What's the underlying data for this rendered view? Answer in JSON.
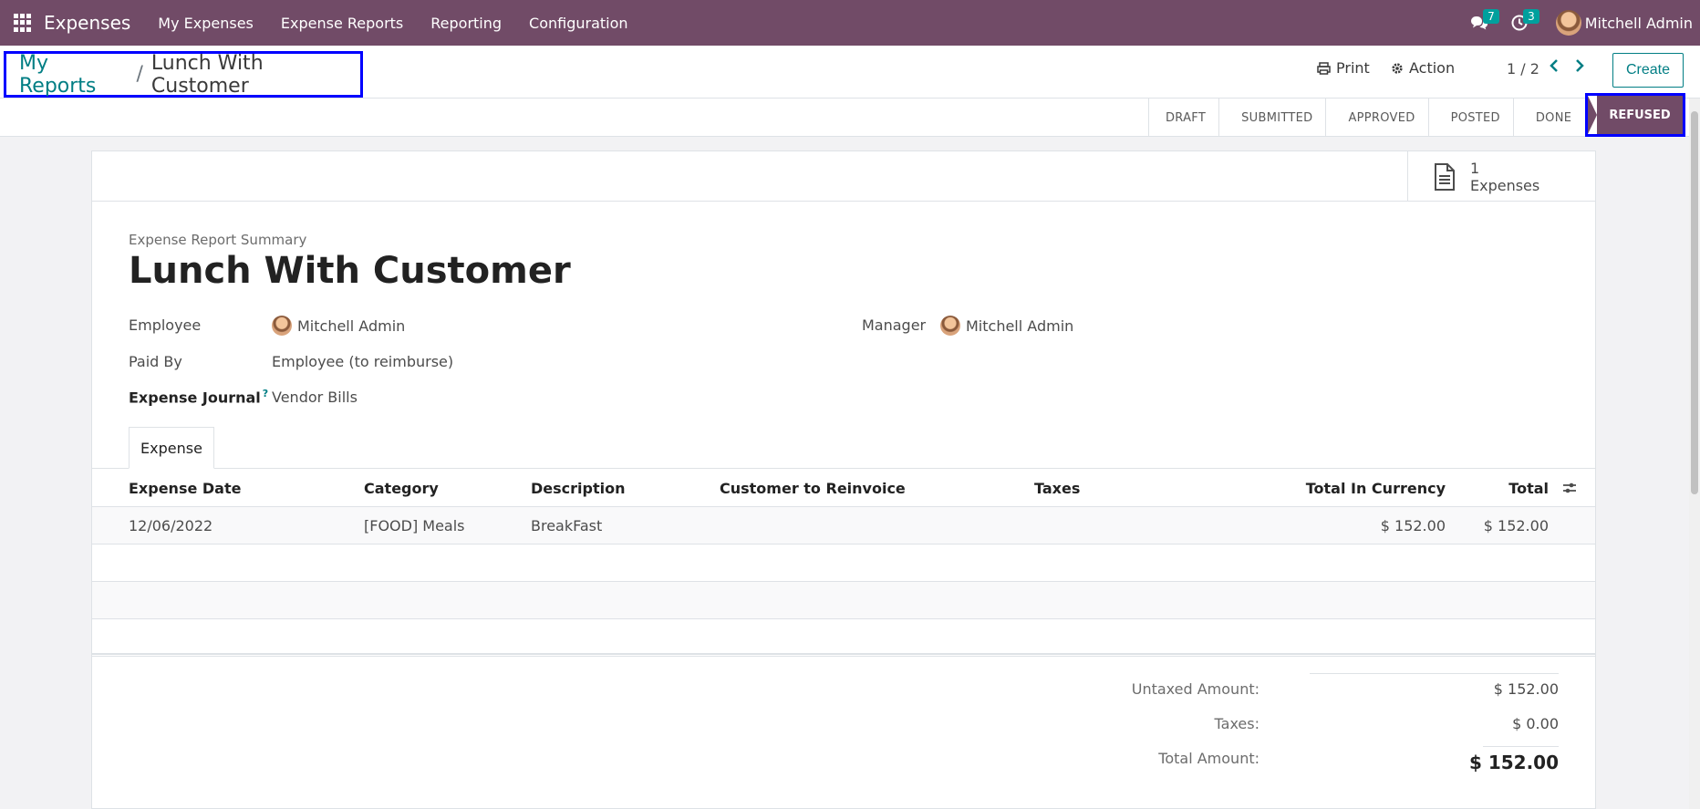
{
  "navbar": {
    "app_name": "Expenses",
    "menu": [
      "My Expenses",
      "Expense Reports",
      "Reporting",
      "Configuration"
    ],
    "messages_count": "7",
    "activities_count": "3",
    "user_name": "Mitchell Admin"
  },
  "control_panel": {
    "breadcrumb_parent": "My Reports",
    "breadcrumb_separator": "/",
    "breadcrumb_current": "Lunch With Customer",
    "print_label": "Print",
    "action_label": "Action",
    "pager_value": "1 / 2",
    "create_label": "Create"
  },
  "statusbar": {
    "stages": [
      "DRAFT",
      "SUBMITTED",
      "APPROVED",
      "POSTED",
      "DONE"
    ],
    "active_stage": "REFUSED"
  },
  "smart_button": {
    "count": "1",
    "label": "Expenses"
  },
  "form": {
    "subtitle": "Expense Report Summary",
    "title": "Lunch With Customer",
    "employee_label": "Employee",
    "employee_value": "Mitchell Admin",
    "manager_label": "Manager",
    "manager_value": "Mitchell Admin",
    "paid_by_label": "Paid By",
    "paid_by_value": "Employee (to reimburse)",
    "journal_label": "Expense Journal",
    "journal_help": "?",
    "journal_value": "Vendor Bills"
  },
  "tabs": [
    "Expense"
  ],
  "table": {
    "columns": [
      "Expense Date",
      "Category",
      "Description",
      "Customer to Reinvoice",
      "Taxes",
      "Total In Currency",
      "Total"
    ],
    "rows": [
      [
        "12/06/2022",
        "[FOOD] Meals",
        "BreakFast",
        "",
        "",
        "$ 152.00",
        "$ 152.00"
      ]
    ]
  },
  "totals": {
    "untaxed_label": "Untaxed Amount:",
    "untaxed_value": "$ 152.00",
    "taxes_label": "Taxes:",
    "taxes_value": "$ 0.00",
    "total_label": "Total Amount:",
    "total_value": "$ 152.00"
  },
  "colors": {
    "brand": "#714b67",
    "accent": "#017e84",
    "badge": "#00a09d",
    "highlight_box": "#0000ff"
  }
}
